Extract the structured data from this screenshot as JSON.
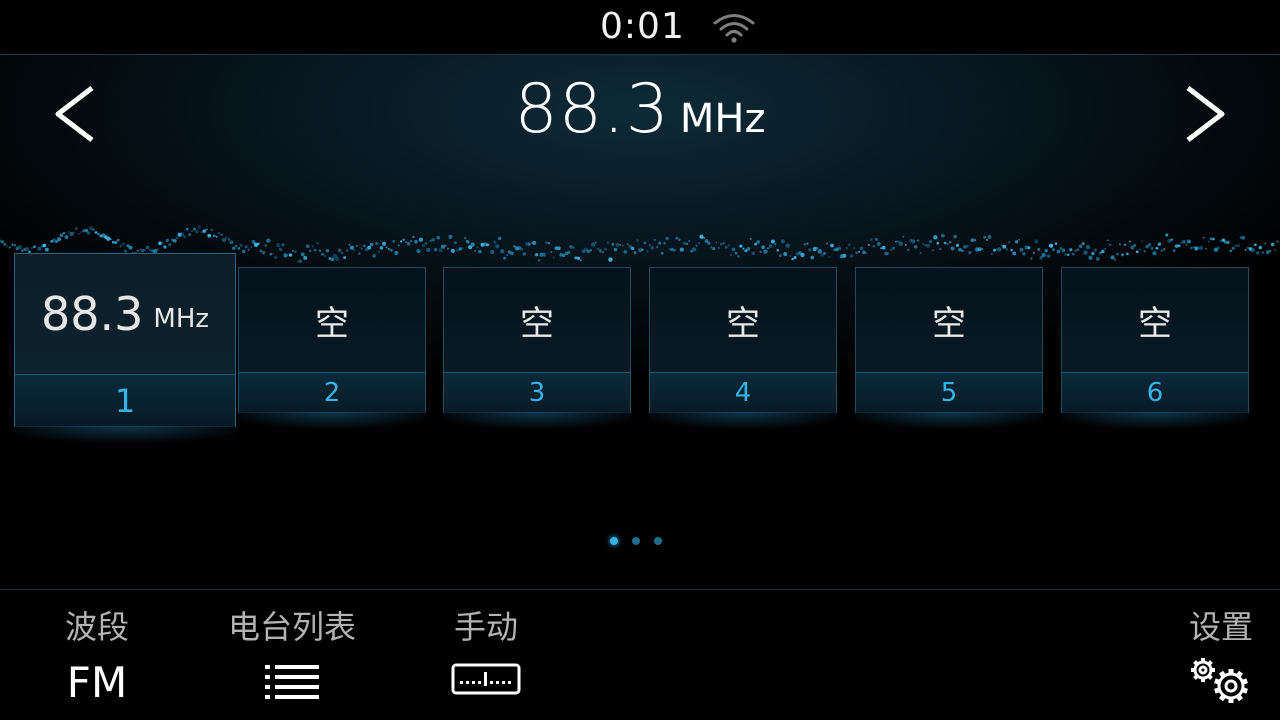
{
  "status": {
    "time": "0:01",
    "wifi_icon": "wifi-icon"
  },
  "header": {
    "frequency": "88.3",
    "unit": "MHz",
    "prev_icon": "chevron-left-icon",
    "next_icon": "chevron-right-icon"
  },
  "presets": [
    {
      "value": "88.3",
      "unit": "MHz",
      "number": "1",
      "selected": true
    },
    {
      "value": "空",
      "number": "2"
    },
    {
      "value": "空",
      "number": "3"
    },
    {
      "value": "空",
      "number": "4"
    },
    {
      "value": "空",
      "number": "5"
    },
    {
      "value": "空",
      "number": "6"
    }
  ],
  "pager": {
    "pages": 3,
    "current": 1
  },
  "bottom": {
    "band_label": "波段",
    "band_value": "FM",
    "station_list_label": "电台列表",
    "station_list_icon": "list-icon",
    "manual_label": "手动",
    "manual_icon": "tuner-scale-icon",
    "settings_label": "设置",
    "settings_icon": "gears-icon"
  },
  "colors": {
    "accent": "#2fb4ea",
    "preset_border": "#1f4a60",
    "background": "#000000"
  }
}
